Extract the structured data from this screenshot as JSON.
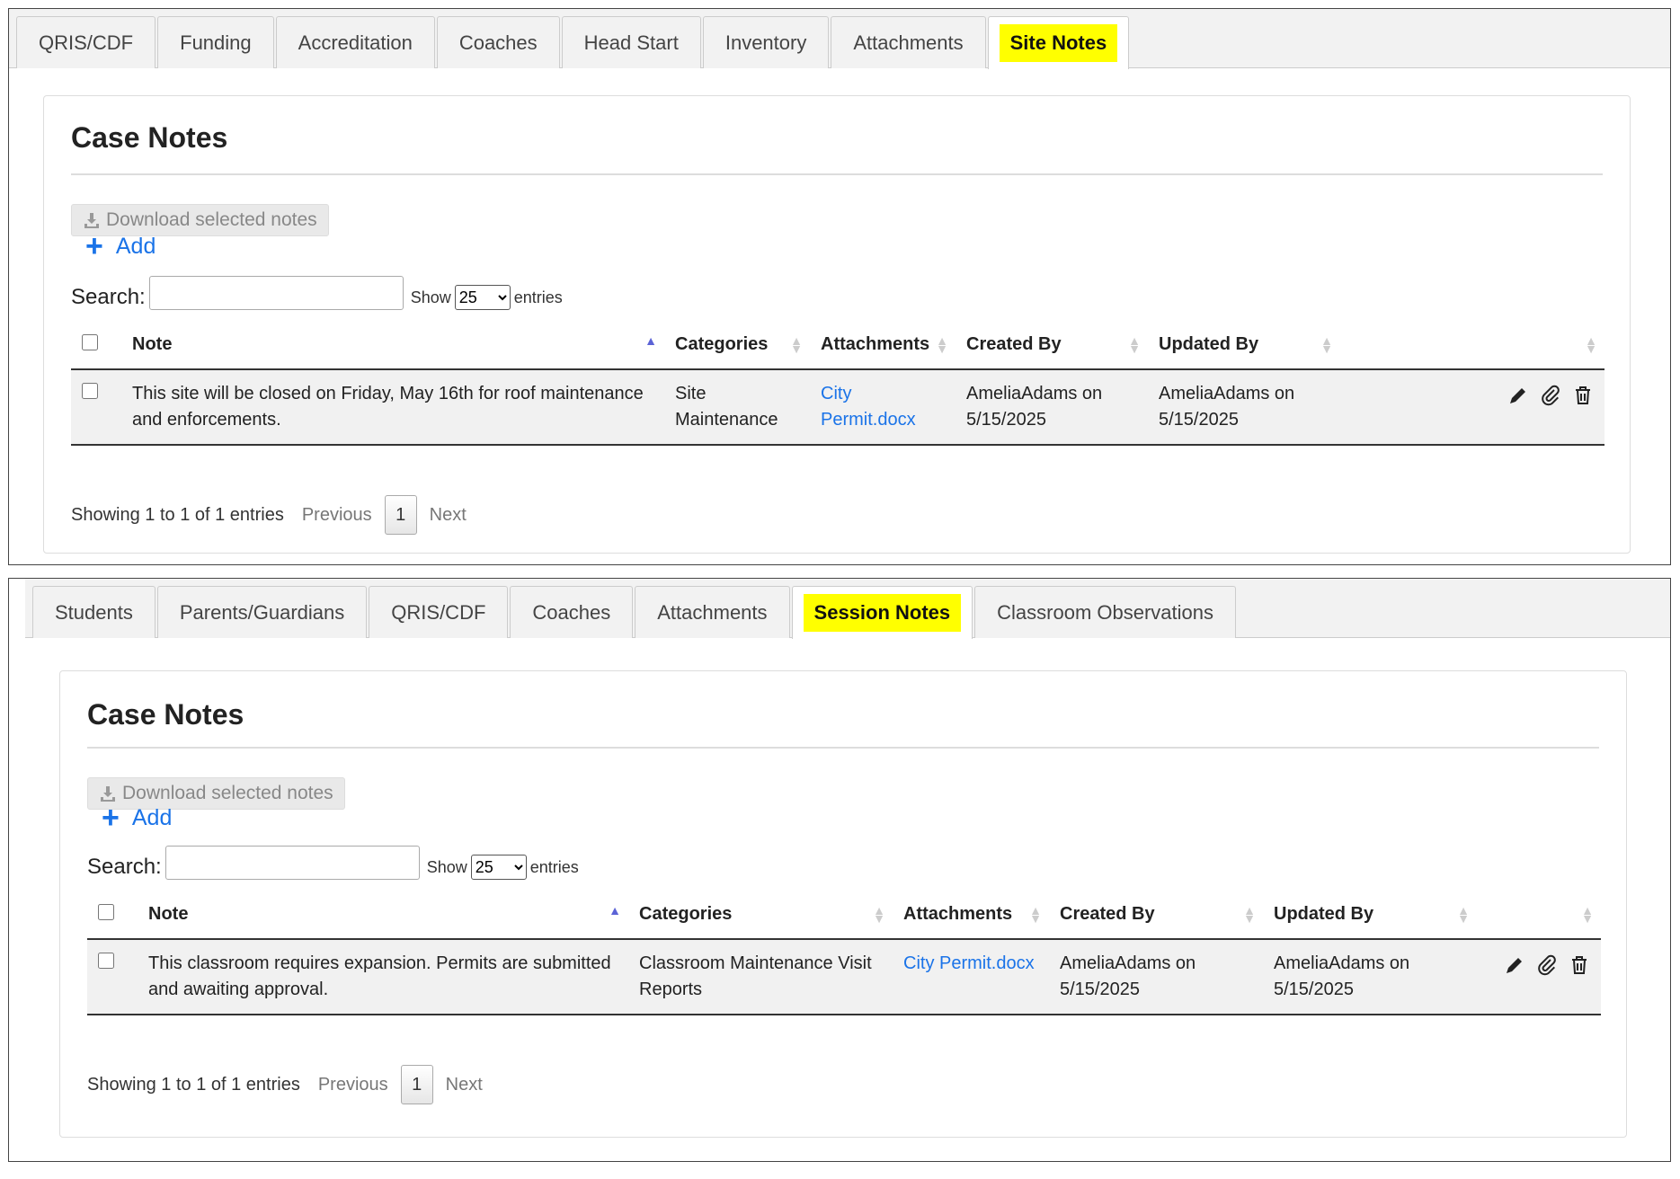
{
  "top": {
    "tabs": [
      "QRIS/CDF",
      "Funding",
      "Accreditation",
      "Coaches",
      "Head Start",
      "Inventory",
      "Attachments",
      "Site Notes"
    ],
    "active_tab": "Site Notes",
    "title": "Case Notes",
    "download_label": "Download selected notes",
    "add_label": "Add",
    "search_label": "Search:",
    "search_value": "",
    "show_label": "Show",
    "show_value": "25",
    "entries_label": "entries",
    "columns": [
      "Note",
      "Categories",
      "Attachments",
      "Created By",
      "Updated By"
    ],
    "rows": [
      {
        "note": "This site will be closed on Friday, May 16th for roof maintenance and enforcements.",
        "category": "Site Maintenance",
        "attachment": "City Permit.docx",
        "created_by": "AmeliaAdams on 5/15/2025",
        "updated_by": "AmeliaAdams on 5/15/2025"
      }
    ],
    "info": "Showing 1 to 1 of 1 entries",
    "prev": "Previous",
    "page": "1",
    "next": "Next"
  },
  "bottom": {
    "tabs": [
      "Students",
      "Parents/Guardians",
      "QRIS/CDF",
      "Coaches",
      "Attachments",
      "Session Notes",
      "Classroom Observations"
    ],
    "active_tab": "Session Notes",
    "title": "Case Notes",
    "download_label": "Download selected notes",
    "add_label": "Add",
    "search_label": "Search:",
    "search_value": "",
    "show_label": "Show",
    "show_value": "25",
    "entries_label": "entries",
    "columns": [
      "Note",
      "Categories",
      "Attachments",
      "Created By",
      "Updated By"
    ],
    "rows": [
      {
        "note": "This classroom requires expansion. Permits are submitted and awaiting approval.",
        "category": "Classroom Maintenance Visit Reports",
        "attachment": "City Permit.docx",
        "created_by": "AmeliaAdams on 5/15/2025",
        "updated_by": "AmeliaAdams on 5/15/2025"
      }
    ],
    "info": "Showing 1 to 1 of 1 entries",
    "prev": "Previous",
    "page": "1",
    "next": "Next"
  },
  "colors": {
    "highlight": "#ffff00",
    "link": "#1a73e8",
    "sort_active": "#5b63d6"
  }
}
